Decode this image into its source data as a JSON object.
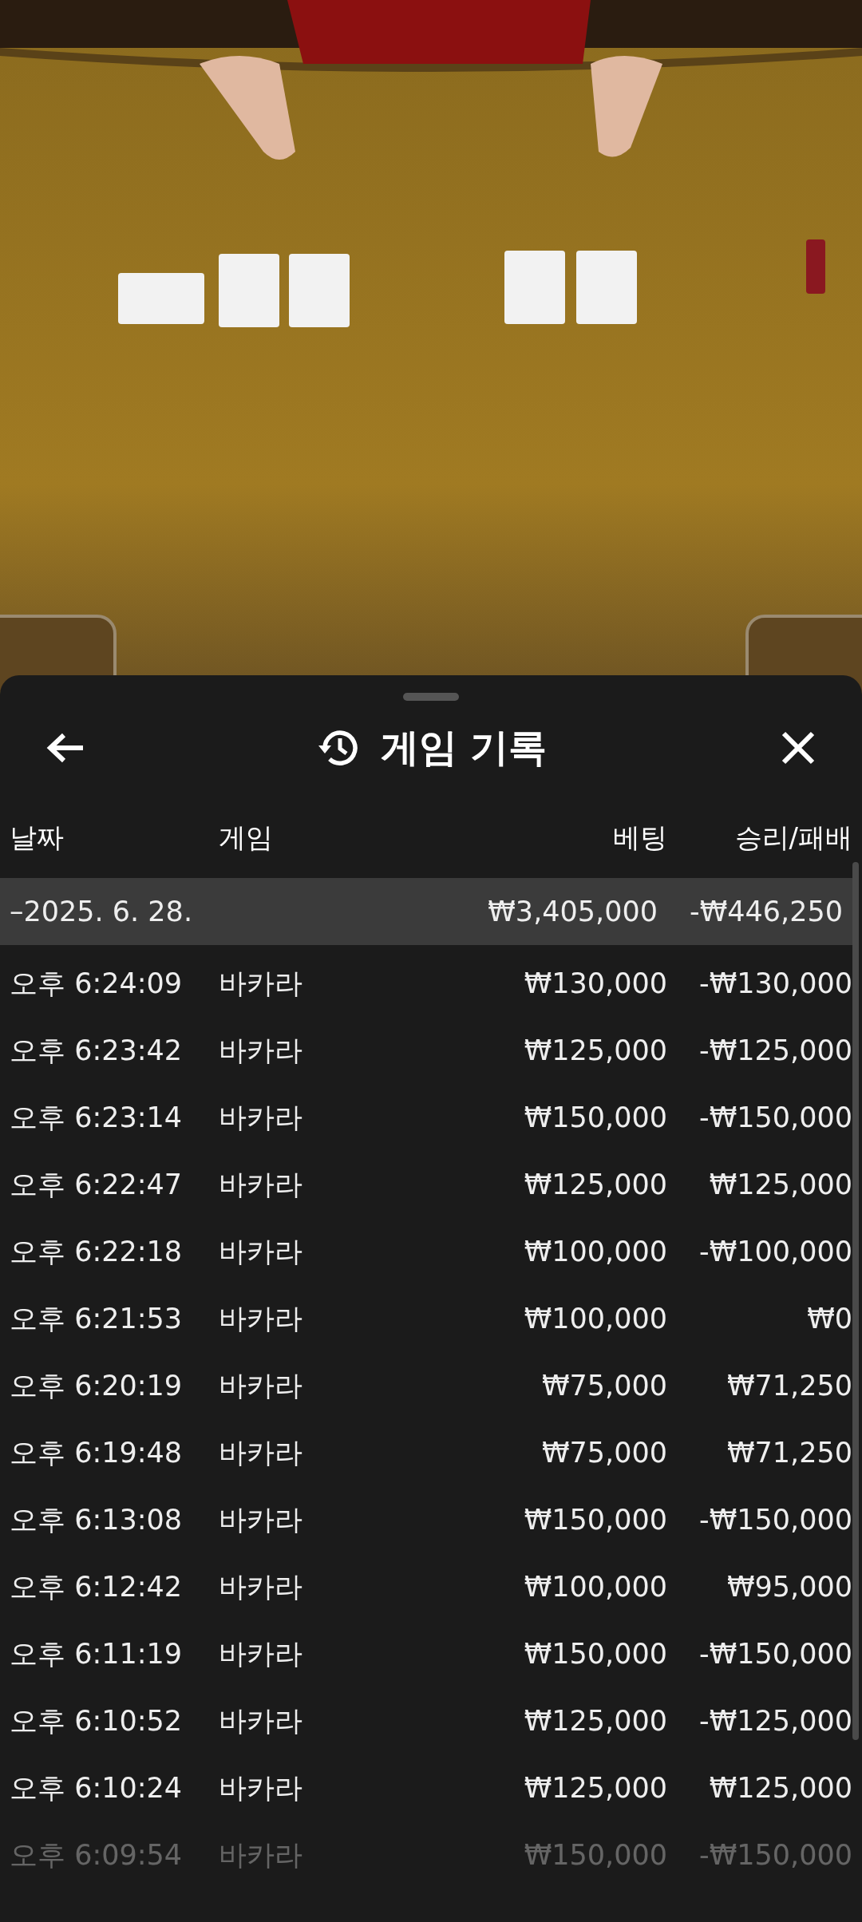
{
  "sheet": {
    "title": "게임 기록"
  },
  "table": {
    "columns": [
      "날짜",
      "게임",
      "베팅",
      "승리/패배"
    ],
    "group": {
      "date": "–2025. 6. 28.",
      "bet": "₩3,405,000",
      "result": "-₩446,250"
    },
    "rows": [
      {
        "time": "오후 6:24:09",
        "game": "바카라",
        "bet": "₩130,000",
        "result": "-₩130,000"
      },
      {
        "time": "오후 6:23:42",
        "game": "바카라",
        "bet": "₩125,000",
        "result": "-₩125,000"
      },
      {
        "time": "오후 6:23:14",
        "game": "바카라",
        "bet": "₩150,000",
        "result": "-₩150,000"
      },
      {
        "time": "오후 6:22:47",
        "game": "바카라",
        "bet": "₩125,000",
        "result": "₩125,000"
      },
      {
        "time": "오후 6:22:18",
        "game": "바카라",
        "bet": "₩100,000",
        "result": "-₩100,000"
      },
      {
        "time": "오후 6:21:53",
        "game": "바카라",
        "bet": "₩100,000",
        "result": "₩0"
      },
      {
        "time": "오후 6:20:19",
        "game": "바카라",
        "bet": "₩75,000",
        "result": "₩71,250"
      },
      {
        "time": "오후 6:19:48",
        "game": "바카라",
        "bet": "₩75,000",
        "result": "₩71,250"
      },
      {
        "time": "오후 6:13:08",
        "game": "바카라",
        "bet": "₩150,000",
        "result": "-₩150,000"
      },
      {
        "time": "오후 6:12:42",
        "game": "바카라",
        "bet": "₩100,000",
        "result": "₩95,000"
      },
      {
        "time": "오후 6:11:19",
        "game": "바카라",
        "bet": "₩150,000",
        "result": "-₩150,000"
      },
      {
        "time": "오후 6:10:52",
        "game": "바카라",
        "bet": "₩125,000",
        "result": "-₩125,000"
      },
      {
        "time": "오후 6:10:24",
        "game": "바카라",
        "bet": "₩125,000",
        "result": "₩125,000"
      },
      {
        "time": "오후 6:09:54",
        "game": "바카라",
        "bet": "₩150,000",
        "result": "-₩150,000"
      }
    ]
  }
}
